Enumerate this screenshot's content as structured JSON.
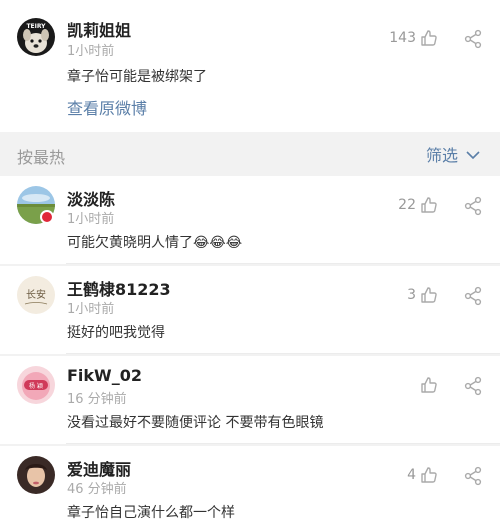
{
  "main_post": {
    "user": "凯莉姐姐",
    "time": "1小时前",
    "likes": "143",
    "text": "章子怡可能是被绑架了",
    "view_original": "查看原微博"
  },
  "sort_bar": {
    "sort_label": "按最热",
    "filter_label": "筛选"
  },
  "comments": [
    {
      "user": "淡淡陈",
      "time": "1小时前",
      "likes": "22",
      "text": "可能欠黄晓明人情了😂😂😂"
    },
    {
      "user": "王鹤棣81223",
      "time": "1小时前",
      "likes": "3",
      "text": "挺好的吧我觉得"
    },
    {
      "user": "FikW_02",
      "time": "16 分钟前",
      "likes": "",
      "text": "没看过最好不要随便评论 不要带有色眼镜"
    },
    {
      "user": "爱迪魔丽",
      "time": "46 分钟前",
      "likes": "4",
      "text": "章子怡自己演什么都一个样"
    }
  ],
  "avatar_texts": {
    "kelly": "TEIRY",
    "wang": "长安",
    "fikw": "杨 颖"
  },
  "colors": {
    "link": "#5b7fa8",
    "meta": "#aaaaaa",
    "badge": "#e0283a"
  }
}
